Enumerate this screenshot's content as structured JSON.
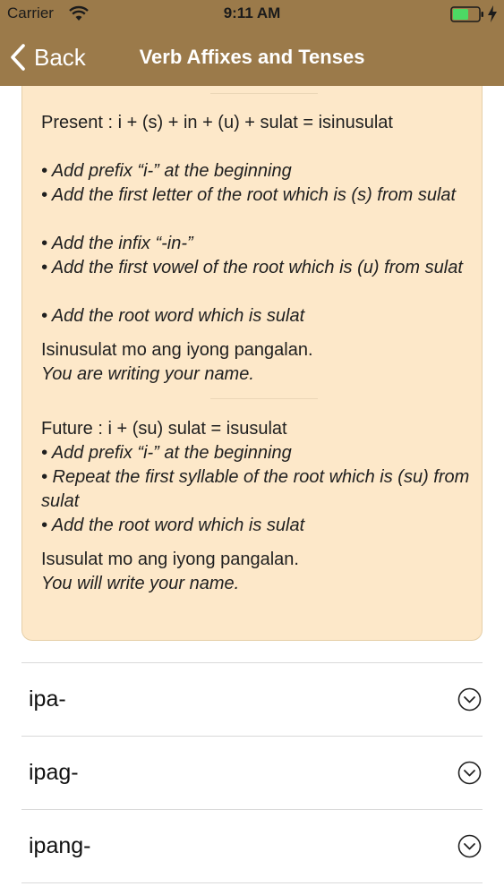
{
  "status_bar": {
    "carrier": "Carrier",
    "time": "9:11 AM",
    "icons": [
      "wifi-icon",
      "battery-icon",
      "charging-icon"
    ]
  },
  "nav": {
    "back_label": "Back",
    "title": "Verb Affixes and Tenses"
  },
  "card": {
    "present_heading": "Present : i + (s) + in + (u) + sulat = isinusulat",
    "present_steps": [
      "• Add prefix “i-” at the beginning",
      "• Add the first letter of the root which is (s) from sulat",
      "• Add the infix “-in-”",
      "• Add the first vowel of the root which is (u) from sulat",
      "• Add the root word which is sulat"
    ],
    "present_example": "Isinusulat mo ang iyong pangalan.",
    "present_translation": "You are writing your name.",
    "future_heading": "Future : i + (su) sulat = isusulat",
    "future_steps": [
      "• Add prefix “i-” at the beginning",
      "• Repeat the first syllable of the root which is (su) from sulat",
      "• Add the root word which is sulat"
    ],
    "future_example": "Isusulat mo ang iyong pangalan.",
    "future_translation": "You will write your name."
  },
  "list": {
    "items": [
      {
        "label": "ipa-"
      },
      {
        "label": "ipag-"
      },
      {
        "label": "ipang-"
      }
    ]
  },
  "colors": {
    "nav_background": "#9b7a4a",
    "card_background": "#fde8c9",
    "battery_fill": "#4cd964"
  }
}
